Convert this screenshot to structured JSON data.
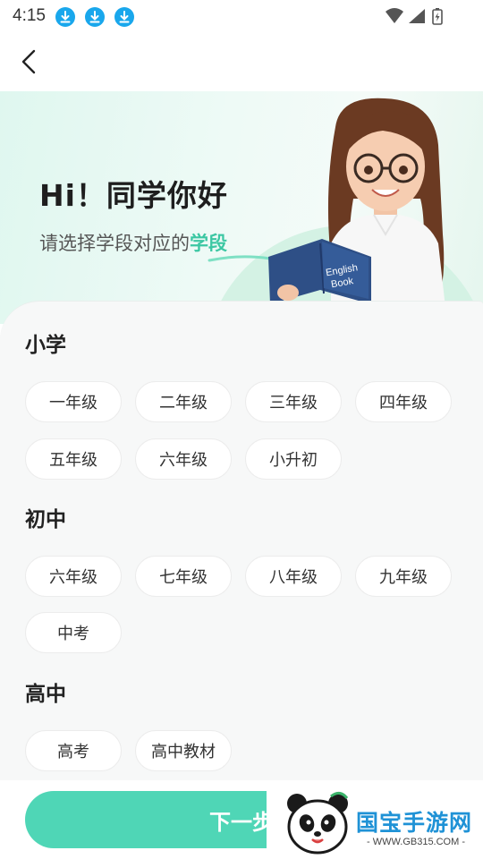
{
  "status_bar": {
    "time": "4:15"
  },
  "hero": {
    "greeting": "Hi！同学你好",
    "subtitle_prefix": "请选择学段对应的",
    "subtitle_highlight": "学段",
    "book_text_1": "English",
    "book_text_2": "Book"
  },
  "sections": [
    {
      "title": "小学",
      "grades": [
        "一年级",
        "二年级",
        "三年级",
        "四年级",
        "五年级",
        "六年级",
        "小升初"
      ]
    },
    {
      "title": "初中",
      "grades": [
        "六年级",
        "七年级",
        "八年级",
        "九年级",
        "中考"
      ]
    },
    {
      "title": "高中",
      "grades": [
        "高考",
        "高中教材"
      ]
    }
  ],
  "footer": {
    "next_label": "下一步"
  },
  "watermark": {
    "brand": "国宝手游网",
    "site": "- WWW.GB315.COM -"
  },
  "colors": {
    "accent": "#4fd6b6",
    "highlight": "#3cc7a3",
    "download_badge": "#19a7ec"
  }
}
